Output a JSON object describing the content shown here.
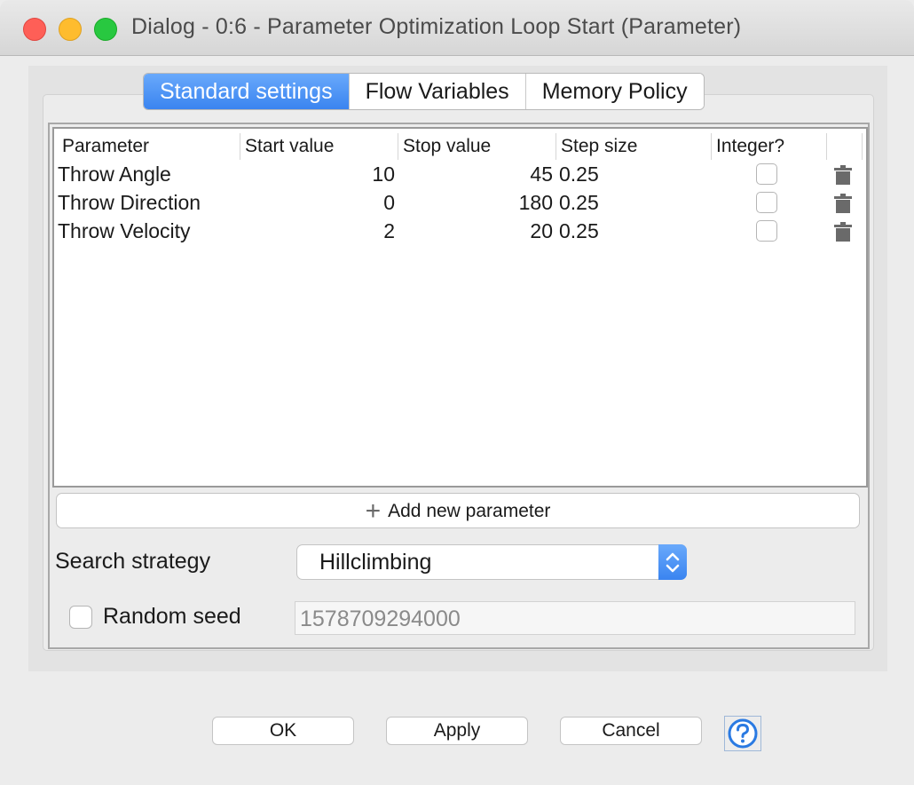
{
  "window": {
    "title": "Dialog - 0:6 - Parameter Optimization Loop Start (Parameter)"
  },
  "tabs": [
    {
      "label": "Standard settings",
      "active": true
    },
    {
      "label": "Flow Variables",
      "active": false
    },
    {
      "label": "Memory Policy",
      "active": false
    }
  ],
  "table": {
    "columns": [
      "Parameter",
      "Start value",
      "Stop value",
      "Step size",
      "Integer?"
    ],
    "rows": [
      {
        "parameter": "Throw Angle",
        "start": "10",
        "stop": "45",
        "step": "0.25",
        "integer": false
      },
      {
        "parameter": "Throw Direction",
        "start": "0",
        "stop": "180",
        "step": "0.25",
        "integer": false
      },
      {
        "parameter": "Throw Velocity",
        "start": "2",
        "stop": "20",
        "step": "0.25",
        "integer": false
      }
    ]
  },
  "add_button": {
    "label": "Add new parameter",
    "icon": "plus-icon"
  },
  "search_strategy": {
    "label": "Search strategy",
    "value": "Hillclimbing"
  },
  "random_seed": {
    "label": "Random seed",
    "checked": false,
    "placeholder": "1578709294000"
  },
  "buttons": {
    "ok": "OK",
    "apply": "Apply",
    "cancel": "Cancel"
  },
  "colors": {
    "accent": "#3a84f0",
    "close": "#fe5f57",
    "minimize": "#febc2e",
    "maximize": "#28c840"
  }
}
